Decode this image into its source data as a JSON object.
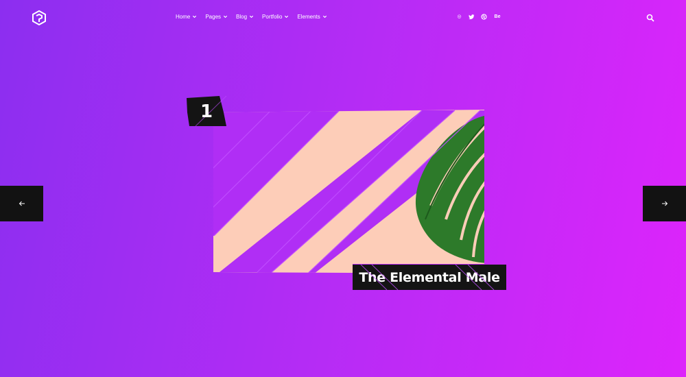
{
  "header": {
    "nav": [
      {
        "label": "Home"
      },
      {
        "label": "Pages"
      },
      {
        "label": "Blog"
      },
      {
        "label": "Portfolio"
      },
      {
        "label": "Elements"
      }
    ],
    "social": [
      {
        "icon": "instagram-icon",
        "glyph": "◎"
      },
      {
        "icon": "twitter-icon",
        "glyph": "🐦"
      },
      {
        "icon": "dribbble-icon",
        "glyph": "⊕"
      },
      {
        "icon": "behance-icon",
        "glyph": "Be"
      }
    ]
  },
  "slide": {
    "number": "1",
    "title": "The Elemental Male"
  },
  "colors": {
    "gradient_start": "#8c2ef0",
    "gradient_end": "#dd24fb",
    "card": "#fdcdb8",
    "dark": "#141414",
    "leaf": "#2d7a2a"
  }
}
